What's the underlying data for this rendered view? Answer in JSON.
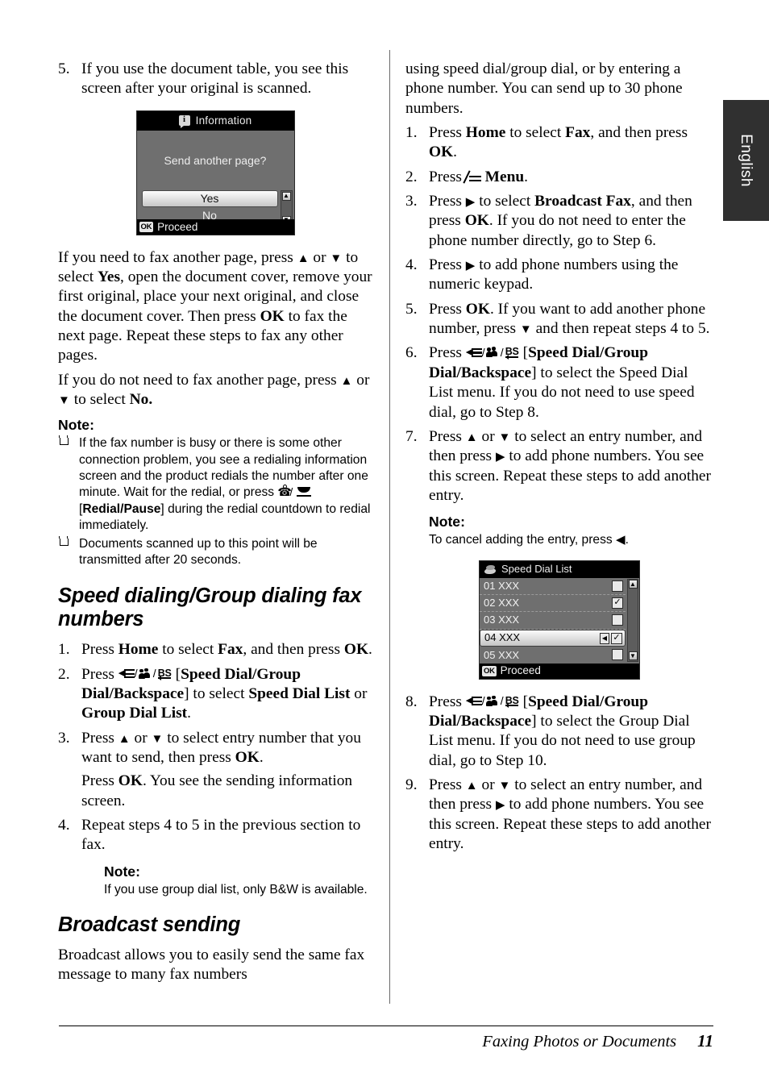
{
  "language_tab": {
    "label": "English"
  },
  "footer": {
    "title": "Faxing Photos or Documents",
    "page": "11"
  },
  "left_column": {
    "step5": {
      "num": "5.",
      "text": "If you use the document table, you see this screen after your original is scanned."
    },
    "lcd_information": {
      "title": "Information",
      "icon": "info-icon",
      "message": "Send another page?",
      "option_yes": "Yes",
      "option_no": "No",
      "ok_key": "OK",
      "footer_label": "Proceed",
      "scroll_up": "▲",
      "scroll_down": "▼"
    },
    "para_yes": {
      "p1": "If you need to fax another page, press ",
      "p2": " or ",
      "p3": " to select ",
      "bold_yes": "Yes",
      "p4": ", open the document cover, remove your first original, place your next original, and close the document cover. Then press ",
      "bold_ok": "OK",
      "p5": " to fax the next page. Repeat these steps to fax any other pages."
    },
    "para_no": {
      "p1": "If you do not need to fax another page, press ",
      "p2": " or ",
      "p3": " to select ",
      "bold_no": "No."
    },
    "note_head": "Note:",
    "note_items": {
      "item1_a": "If the fax number is busy or there is some other connection problem, you see a redialing information screen and the product redials the number after one minute. Wait for the redial, or press ",
      "item1_bracket_open": " [",
      "item1_bold": "Redial/Pause",
      "item1_b": "] during the redial countdown to redial immediately.",
      "item2": "Documents scanned up to this point will be transmitted after 20 seconds."
    },
    "heading_speed": "Speed dialing/Group dialing fax numbers",
    "speed_steps": {
      "s1_num": "1.",
      "s1_a": "Press ",
      "s1_bold_home": "Home",
      "s1_b": " to select ",
      "s1_bold_fax": "Fax",
      "s1_c": ", and then press ",
      "s1_bold_ok": "OK",
      "s1_d": ".",
      "s2_num": "2.",
      "s2_a": "Press ",
      "s2_bracket_open": " [",
      "s2_bold1": "Speed Dial/Group Dial/Backspace",
      "s2_b": "] to select ",
      "s2_bold2": "Speed Dial List",
      "s2_c": " or ",
      "s2_bold3": "Group Dial List",
      "s2_d": ".",
      "s3_num": "3.",
      "s3_a": "Press ",
      "s3_b": " or ",
      "s3_c": " to select entry number that you want to send, then press ",
      "s3_bold_ok": "OK",
      "s3_d": ".",
      "s3_sub_a": "Press ",
      "s3_sub_bold": "OK",
      "s3_sub_b": ". You see the sending information screen.",
      "s4_num": "4.",
      "s4": "Repeat steps 4 to 5 in the previous section to fax."
    },
    "note2_head": "Note:",
    "note2_body": "If you use group dial list, only B&W is available.",
    "heading_broadcast": "Broadcast sending",
    "broadcast_intro": "Broadcast allows you to easily send the same fax message to many fax numbers"
  },
  "right_column": {
    "intro_cont": "using speed dial/group dial, or by entering a phone number. You can send up to 30 phone numbers.",
    "steps": {
      "s1_num": "1.",
      "s1_a": "Press ",
      "s1_bold_home": "Home",
      "s1_b": " to select ",
      "s1_bold_fax": "Fax",
      "s1_c": ", and then press ",
      "s1_bold_ok": "OK",
      "s1_d": ".",
      "s2_num": "2.",
      "s2_a": "Press ",
      "s2_bold_menu": "Menu",
      "s2_b": ".",
      "s3_num": "3.",
      "s3_a": "Press ",
      "s3_b": " to select ",
      "s3_bold": "Broadcast Fax",
      "s3_c": ", and then press ",
      "s3_bold_ok": "OK",
      "s3_d": ". If you do not need to enter the phone number directly, go to Step 6.",
      "s4_num": "4.",
      "s4_a": "Press ",
      "s4_b": " to add phone numbers using the numeric keypad.",
      "s5_num": "5.",
      "s5_a": "Press ",
      "s5_bold_ok": "OK",
      "s5_b": ". If you want to add another phone number, press ",
      "s5_c": " and then repeat steps 4 to 5.",
      "s6_num": "6.",
      "s6_a": "Press ",
      "s6_bracket_open": " [",
      "s6_bold": "Speed Dial/Group Dial/Backspace",
      "s6_b": "] to select the Speed Dial List menu. If you do not need to use speed dial, go to Step 8.",
      "s7_num": "7.",
      "s7_a": "Press ",
      "s7_b": " or ",
      "s7_c": " to select an entry number, and then press ",
      "s7_d": " to add phone numbers. You see this screen. Repeat these steps to add another entry.",
      "s7_note_head": "Note:",
      "s7_note_a": "To cancel adding the entry, press ",
      "s7_note_b": ".",
      "s8_num": "8.",
      "s8_a": "Press ",
      "s8_bracket_open": " [",
      "s8_bold": "Speed Dial/Group Dial/Backspace",
      "s8_b": "] to select the Group Dial List menu. If you do not need to use group dial, go to Step 10.",
      "s9_num": "9.",
      "s9_a": "Press ",
      "s9_b": " or ",
      "s9_c": " to select an entry number, and then press ",
      "s9_d": " to add phone numbers. You see this screen. Repeat these steps to add another entry."
    },
    "lcd_speed_dial": {
      "title": "Speed Dial List",
      "icon": "speed-dial-icon",
      "rows": [
        {
          "label": "01 XXX",
          "checked": false,
          "selected": false
        },
        {
          "label": "02 XXX",
          "checked": true,
          "selected": false
        },
        {
          "label": "03 XXX",
          "checked": false,
          "selected": false
        },
        {
          "label": "04 XXX",
          "checked": true,
          "selected": true
        },
        {
          "label": "05 XXX",
          "checked": false,
          "selected": false
        }
      ],
      "check_glyph": "✓",
      "left_arrow": "◀",
      "ok_key": "OK",
      "footer_label": "Proceed",
      "scroll_up": "▲",
      "scroll_down": "▼"
    }
  },
  "glyphs": {
    "triangle_up": "▲",
    "triangle_down": "▼",
    "triangle_right": "▶",
    "triangle_left": "◀",
    "menu_icon": "menu-icon",
    "speed_dial_icon": "speed-dial-group-dial-backspace-icon",
    "redial_icon": "redial-pause-icon"
  }
}
